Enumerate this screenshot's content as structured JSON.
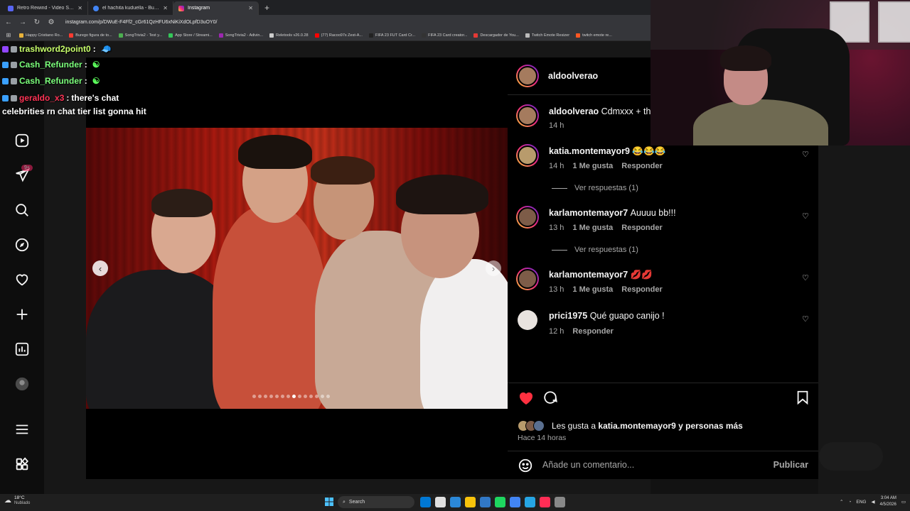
{
  "browser": {
    "tabs": [
      {
        "label": "Retro Rewind - Video Store Sim",
        "color": "#5865f2"
      },
      {
        "label": "el hachita kuduella - Buscar con Google",
        "color": "#4285f4"
      },
      {
        "label": "Instagram",
        "color": "#e1306c",
        "active": true
      }
    ],
    "new_tab": "+",
    "url": "instagram.com/p/DWuE-F4Ff2_cGr61QzHFU6xNiKiXdOLpfD3uOY0/",
    "bookmarks": [
      {
        "label": "Happy Cristiano Ro...",
        "color": "#e8b23a"
      },
      {
        "label": "Burego figura de to...",
        "color": "#ff3b30"
      },
      {
        "label": "SongTrivia2 - Test y...",
        "color": "#4caf50"
      },
      {
        "label": "App Store / Streami...",
        "color": "#34c759"
      },
      {
        "label": "SongTrivia2 - Adivin...",
        "color": "#9c27b0"
      },
      {
        "label": "Reletools v26.0.28",
        "color": "#cccccc"
      },
      {
        "label": "(77) Racoo97s Zest-A...",
        "color": "#ff0000"
      },
      {
        "label": "FIFA 23 FUT Card Cr...",
        "color": "#222222"
      },
      {
        "label": "FIFA 23 Card creator...",
        "color": "#333333"
      },
      {
        "label": "Descargador de You...",
        "color": "#e53935"
      },
      {
        "label": "Twitch Emote Resizer",
        "color": "#bbbbbb"
      },
      {
        "label": "twitch emote re...",
        "color": "#ff5722"
      }
    ]
  },
  "chat": [
    {
      "user": "trashword2point0",
      "suffix": " :",
      "msg": "",
      "color": "#c8ff6b",
      "emote": "🧢"
    },
    {
      "user": "Cash_Refunder",
      "suffix": " :",
      "msg": "",
      "color": "#7bff7b",
      "emote": "☯"
    },
    {
      "user": "Cash_Refunder",
      "suffix": " :",
      "msg": "",
      "color": "#7bff7b",
      "emote": "☯"
    },
    {
      "user": "geraldo_x3",
      "suffix": " :",
      "msg": " there's chat",
      "color": "#ff3355",
      "emote": ""
    },
    {
      "user": "",
      "suffix": "",
      "msg": "celebrities rn chat tier list gonna hit",
      "color": "#ffffff",
      "emote": ""
    }
  ],
  "rail": {
    "badge": "9+",
    "icons": [
      "reels-icon",
      "messages-icon",
      "search-icon",
      "explore-icon",
      "notifications-heart-icon",
      "create-plus-icon",
      "dashboard-icon",
      "profile-icon",
      "menu-icon",
      "more-apps-icon"
    ]
  },
  "post": {
    "author": "aldoolverao",
    "caption_user": "aldoolverao",
    "caption_text": "Cdmxxx + the",
    "caption_time": "14 h",
    "dots_total": 14,
    "dot_active": 7
  },
  "comments": [
    {
      "user": "katia.montemayor9",
      "text": "😂😂😂",
      "time": "14 h",
      "likes": "1 Me gusta",
      "reply": "Responder",
      "view_replies": "Ver respuestas (1)"
    },
    {
      "user": "karlamontemayor7",
      "text": "Auuuu bb!!!",
      "time": "13 h",
      "likes": "1 Me gusta",
      "reply": "Responder",
      "view_replies": "Ver respuestas (1)"
    },
    {
      "user": "karlamontemayor7",
      "text": "💋💋",
      "time": "13 h",
      "likes": "1 Me gusta",
      "reply": "Responder",
      "view_replies": ""
    },
    {
      "user": "prici1975",
      "text": "Qué guapo canijo !",
      "time": "12 h",
      "likes": "",
      "reply": "Responder",
      "view_replies": ""
    }
  ],
  "actions": {
    "likes_prefix": "Les gusta a",
    "likes_user": "katia.montemayor9",
    "likes_suffix": "y personas más",
    "ago": "Hace 14 horas",
    "comment_placeholder": "Añade un comentario...",
    "publish": "Publicar",
    "liked_color": "#ff3040"
  },
  "taskbar": {
    "temp": "18°C",
    "weather": "Nublado",
    "search": "Search",
    "lang": "ENG",
    "time": "3:04 AM",
    "date": "4/5/2026",
    "apps": [
      "#0078d4",
      "#e0e0e0",
      "#2b88d8",
      "#f9c30b",
      "#3178c6",
      "#1ed760",
      "#4285f4",
      "#26a5e4",
      "#ff2d55",
      "#888888"
    ]
  }
}
